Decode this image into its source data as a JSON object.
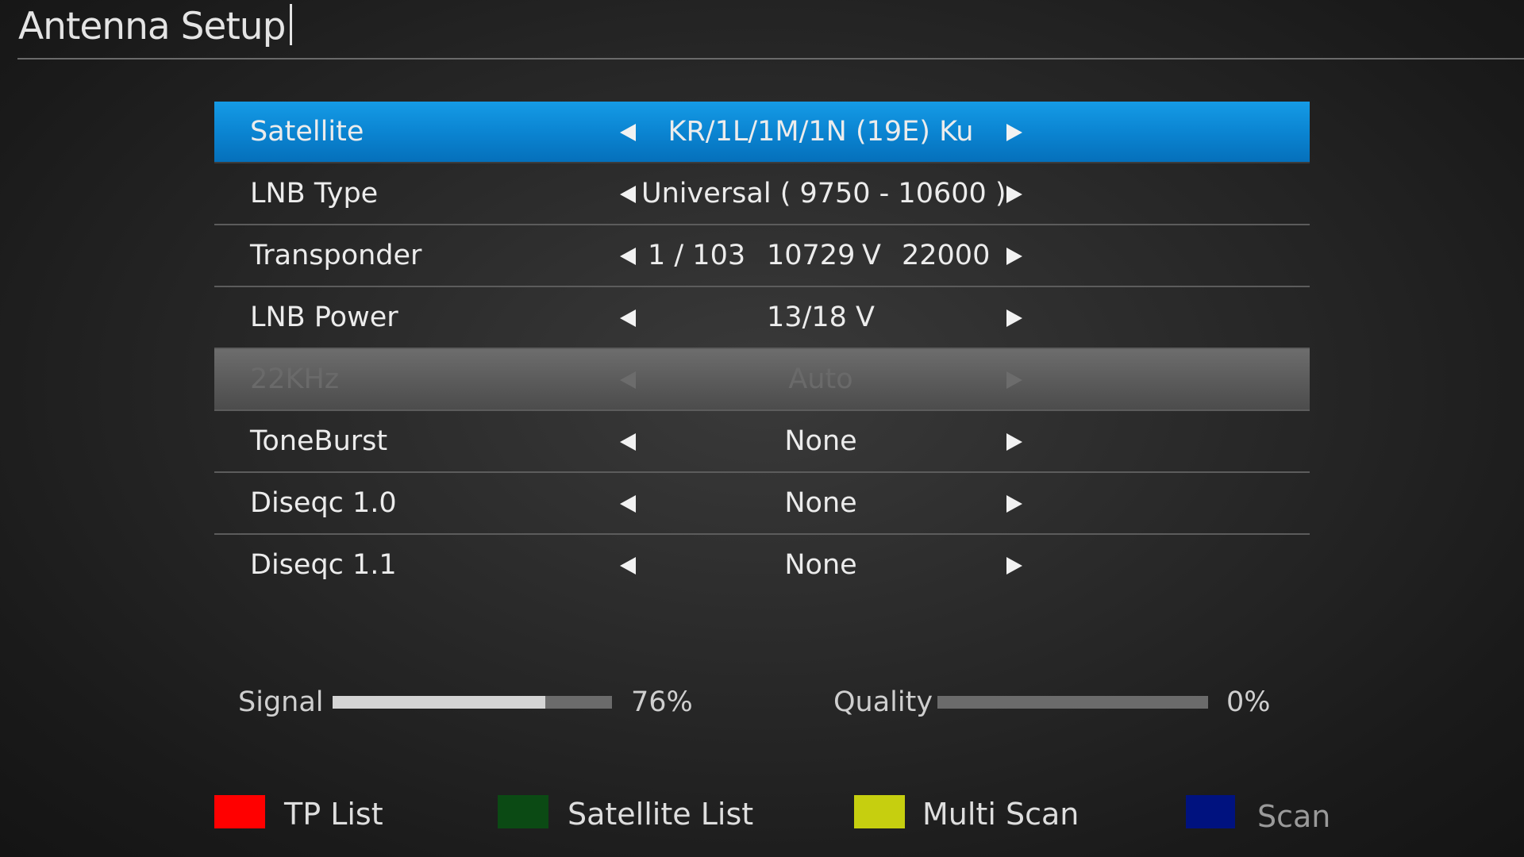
{
  "header": {
    "title": "Antenna Setup"
  },
  "menu": {
    "rows": [
      {
        "label": "Satellite",
        "value": "KR/1L/1M/1N (19E) Ku",
        "state": "selected"
      },
      {
        "label": "LNB Type",
        "value": "Universal ( 9750 - 10600 )",
        "state": "normal"
      },
      {
        "label": "Transponder",
        "value_parts": {
          "index": "1 / 103",
          "frequency": "10729",
          "polarity": "V",
          "symbol_rate": "22000"
        },
        "state": "normal"
      },
      {
        "label": "LNB Power",
        "value": "13/18 V",
        "state": "normal"
      },
      {
        "label": "22KHz",
        "value": "Auto",
        "state": "disabled"
      },
      {
        "label": "ToneBurst",
        "value": "None",
        "state": "normal"
      },
      {
        "label": "Diseqc 1.0",
        "value": "None",
        "state": "normal"
      },
      {
        "label": "Diseqc 1.1",
        "value": "None",
        "state": "normal"
      }
    ]
  },
  "meters": {
    "signal": {
      "label": "Signal",
      "value_text": "76%",
      "level": 0.76
    },
    "quality": {
      "label": "Quality",
      "value_text": "0%",
      "level": 0.0
    }
  },
  "legend": [
    {
      "label": "TP List",
      "color": "#ff0000",
      "icon": "red-key-icon"
    },
    {
      "label": "Satellite List",
      "color": "#0b4a14",
      "icon": "green-key-icon"
    },
    {
      "label": "Multi Scan",
      "color": "#c6cf0f",
      "icon": "yellow-key-icon"
    },
    {
      "label": "Scan",
      "color": "#00127f",
      "icon": "blue-key-icon"
    }
  ],
  "colors": {
    "selected_row": "#0b85d2",
    "disabled_row": "#5c5c5c"
  }
}
